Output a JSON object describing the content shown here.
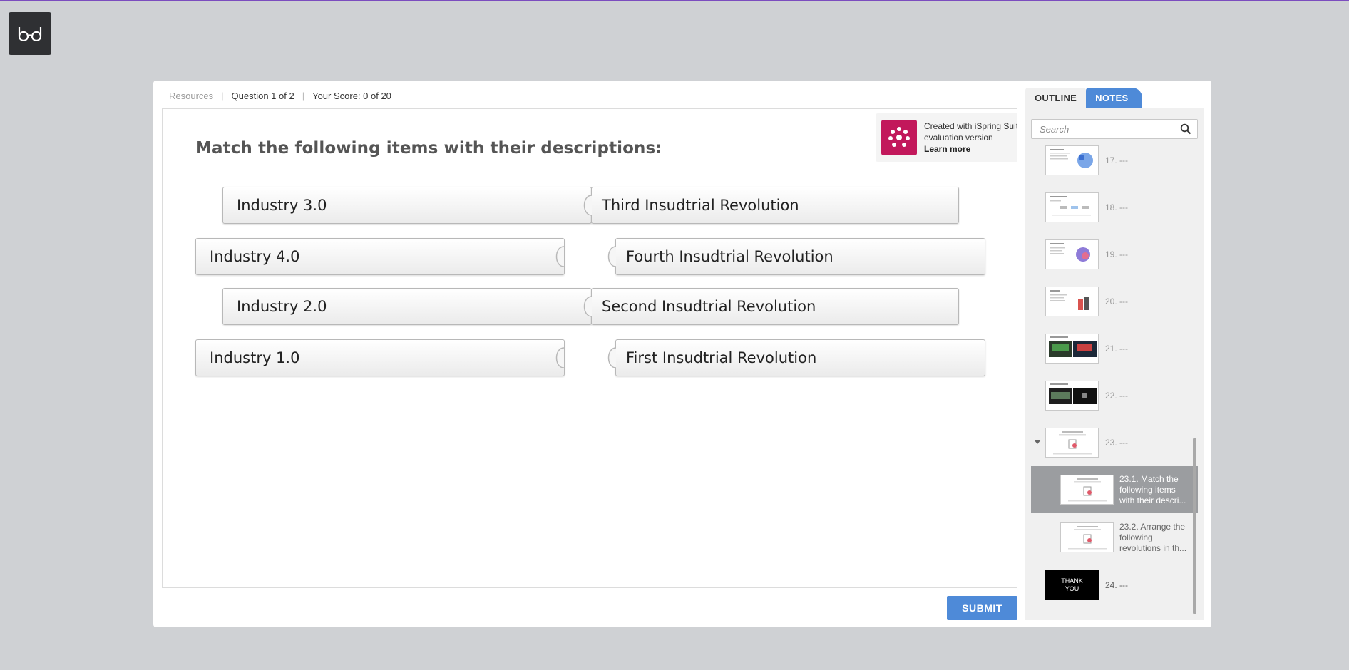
{
  "toolbar": {
    "resources": "Resources",
    "question": "Question 1 of 2",
    "score": "Your Score: 0 of 20"
  },
  "question": {
    "title": "Match the following items with their descriptions:",
    "pairs": [
      {
        "left": "Industry 3.0",
        "right": "Third Insudtrial Revolution",
        "connected": true
      },
      {
        "left": "Industry 4.0",
        "right": "Fourth Insudtrial Revolution",
        "connected": false
      },
      {
        "left": "Industry 2.0",
        "right": "Second Insudtrial Revolution",
        "connected": true
      },
      {
        "left": "Industry 1.0",
        "right": "First Insudtrial Revolution",
        "connected": false
      }
    ]
  },
  "badge": {
    "line1": "Created with iSpring Suite",
    "line2": "evaluation version",
    "link": "Learn more",
    "color": "#c2185b"
  },
  "submit_label": "SUBMIT",
  "sidebar": {
    "tab_outline": "OUTLINE",
    "tab_notes": "NOTES",
    "search_placeholder": "Search",
    "items": [
      {
        "label": "17. ---"
      },
      {
        "label": "18. ---"
      },
      {
        "label": "19. ---"
      },
      {
        "label": "20. ---"
      },
      {
        "label": "21. ---"
      },
      {
        "label": "22. ---"
      },
      {
        "label": "23. ---"
      }
    ],
    "subitems": [
      {
        "label": "23.1. Match the following items with their descri...",
        "active": true
      },
      {
        "label": "23.2.  Arrange the following revolutions in th...",
        "active": false
      }
    ],
    "last_item": {
      "label": "24. ---",
      "thumb_text_1": "THANK",
      "thumb_text_2": "YOU"
    }
  },
  "colors": {
    "accent": "#4e8ad8",
    "active_item": "#9b9da0",
    "topline": "#7c4dbf"
  }
}
